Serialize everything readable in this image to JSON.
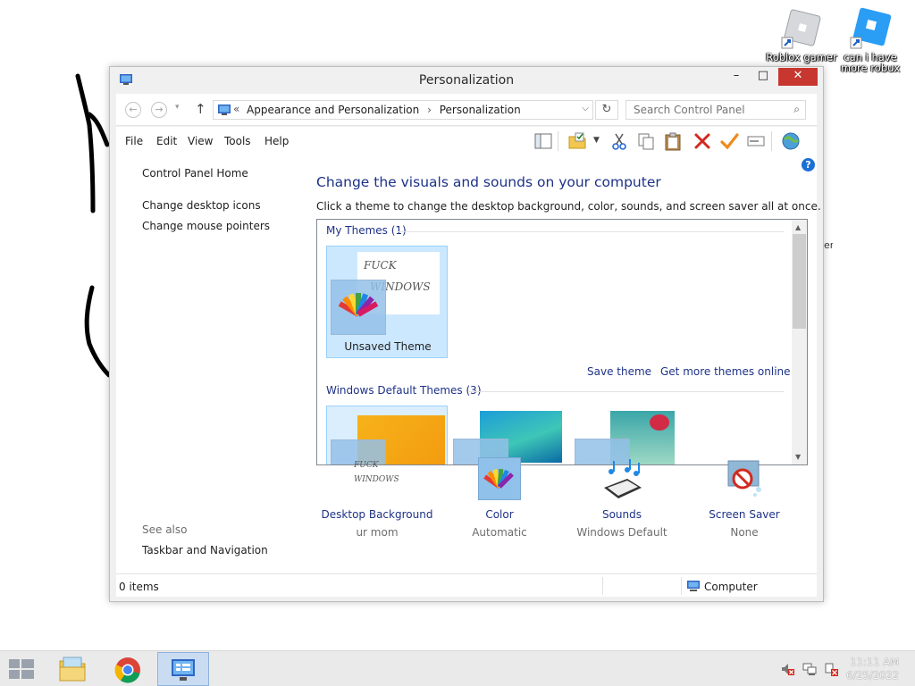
{
  "desktop": {
    "icons": [
      {
        "label": "Roblox gamer"
      },
      {
        "label": "can i have more robux"
      }
    ],
    "stray_text": "er"
  },
  "window": {
    "title": "Personalization",
    "controls": {
      "minimize": "–",
      "maximize": "□",
      "close": "✕"
    },
    "address": {
      "prefix": "«",
      "crumb1": "Appearance and Personalization",
      "separator": "›",
      "crumb2": "Personalization"
    },
    "search": {
      "placeholder": "Search Control Panel"
    },
    "menu": [
      "File",
      "Edit",
      "View",
      "Tools",
      "Help"
    ],
    "left_pane": {
      "home": "Control Panel Home",
      "links": [
        "Change desktop icons",
        "Change mouse pointers"
      ],
      "see_also": "See also",
      "see_also_links": [
        "Taskbar and Navigation"
      ]
    },
    "main": {
      "title": "Change the visuals and sounds on your computer",
      "description": "Click a theme to change the desktop background, color, sounds, and screen saver all at once.",
      "my_themes_header": "My Themes (1)",
      "unsaved_theme": {
        "label": "Unsaved Theme",
        "handwriting_line1": "FUCK",
        "handwriting_line2": "WINDOWS"
      },
      "save_theme": "Save theme",
      "get_more": "Get more themes online",
      "default_themes_header": "Windows Default Themes (3)",
      "help": "?"
    },
    "quick_links": [
      {
        "name": "Desktop Background",
        "value": "ur mom",
        "thumb_line1": "FUCK",
        "thumb_line2": "WINDOWS"
      },
      {
        "name": "Color",
        "value": "Automatic"
      },
      {
        "name": "Sounds",
        "value": "Windows Default"
      },
      {
        "name": "Screen Saver",
        "value": "None"
      }
    ],
    "status": {
      "left": "0 items",
      "right": "Computer"
    }
  },
  "taskbar": {
    "time": "11:11 AM",
    "date": "6/25/2022"
  },
  "colors": {
    "link_blue": "#1e3287",
    "close_red": "#c7372f",
    "selected_tile": "#cce8ff"
  }
}
